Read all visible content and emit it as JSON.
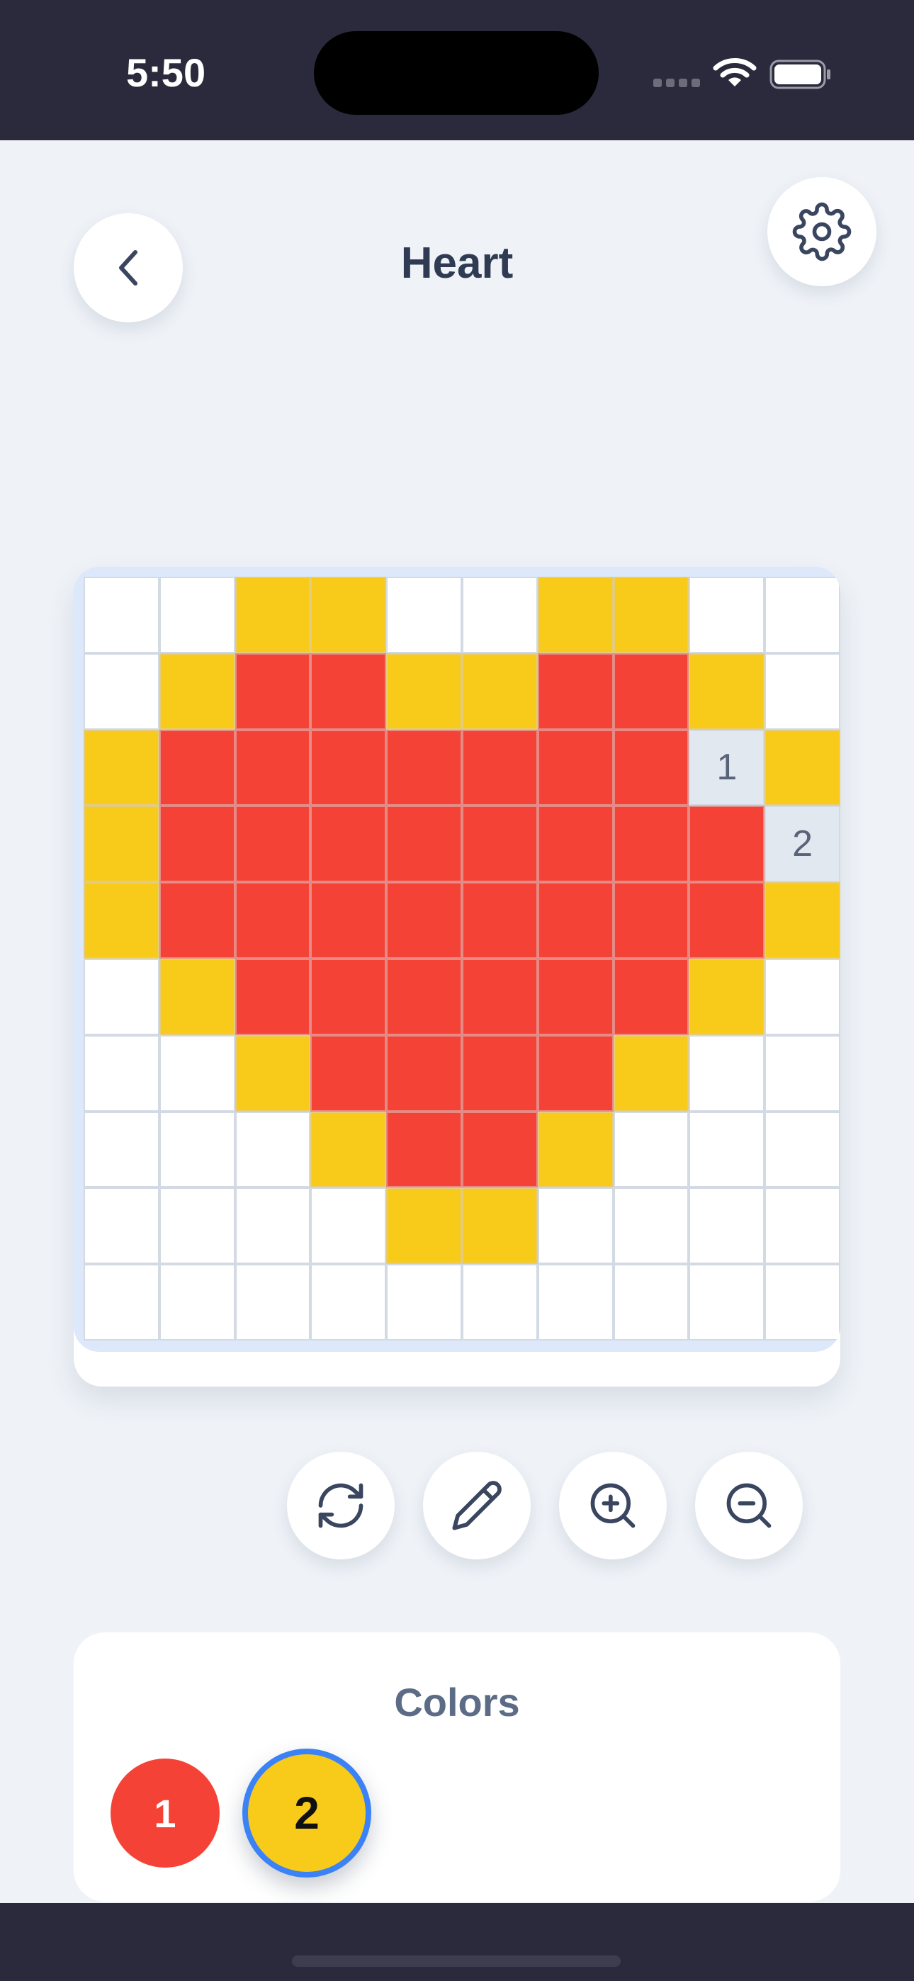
{
  "status_bar": {
    "time": "5:50"
  },
  "header": {
    "title": "Heart",
    "back_icon": "chevron-left-icon",
    "settings_icon": "gear-icon"
  },
  "board": {
    "rows": [
      [
        0,
        0,
        2,
        2,
        0,
        0,
        2,
        2,
        0,
        0
      ],
      [
        0,
        2,
        1,
        1,
        2,
        2,
        1,
        1,
        2,
        0
      ],
      [
        2,
        1,
        1,
        1,
        1,
        1,
        1,
        1,
        "1",
        2
      ],
      [
        2,
        1,
        1,
        1,
        1,
        1,
        1,
        1,
        1,
        "2"
      ],
      [
        2,
        1,
        1,
        1,
        1,
        1,
        1,
        1,
        1,
        2
      ],
      [
        0,
        2,
        1,
        1,
        1,
        1,
        1,
        1,
        2,
        0
      ],
      [
        0,
        0,
        2,
        1,
        1,
        1,
        1,
        2,
        0,
        0
      ],
      [
        0,
        0,
        0,
        2,
        1,
        1,
        2,
        0,
        0,
        0
      ],
      [
        0,
        0,
        0,
        0,
        2,
        2,
        0,
        0,
        0,
        0
      ],
      [
        0,
        0,
        0,
        0,
        0,
        0,
        0,
        0,
        0,
        0
      ]
    ],
    "palette": {
      "0": "#ffffff",
      "1": "#f44336",
      "2": "#f8cb1b"
    }
  },
  "tools": [
    {
      "name": "rotate-icon"
    },
    {
      "name": "pencil-icon"
    },
    {
      "name": "zoom-in-icon"
    },
    {
      "name": "zoom-out-icon"
    }
  ],
  "colors_panel": {
    "title": "Colors",
    "swatches": [
      {
        "label": "1",
        "color": "#f44336",
        "selected": false
      },
      {
        "label": "2",
        "color": "#f8cb1b",
        "selected": true
      }
    ]
  },
  "theme": {
    "background": "#eff3f8",
    "accent": "#3b82f6",
    "bars": "#2a2a3c"
  }
}
